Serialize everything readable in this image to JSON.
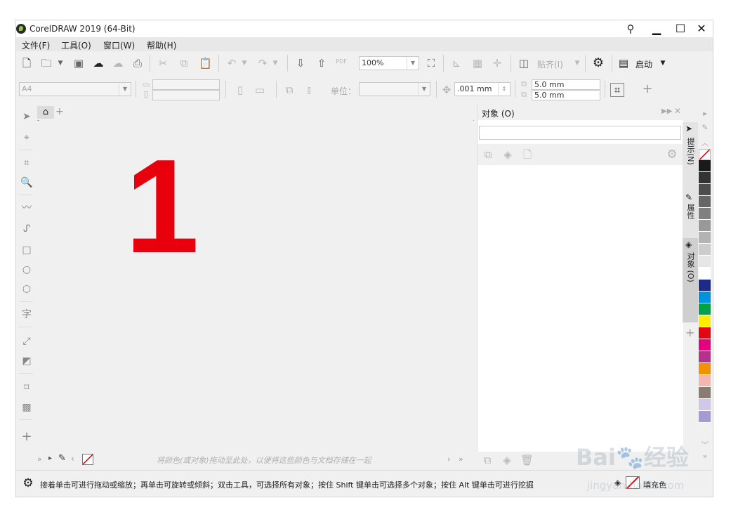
{
  "window": {
    "title": "CorelDRAW 2019 (64-Bit)",
    "minimize": "▁",
    "maximize": "☐",
    "close": "✕"
  },
  "menu": [
    "文件(F)",
    "工具(O)",
    "窗口(W)",
    "帮助(H)"
  ],
  "toolbar": {
    "zoom_value": "100%",
    "snap_label": "贴齐(I)",
    "launch_label": "启动",
    "pdf_icon_label": "PDF"
  },
  "property_bar": {
    "page_size": "A4",
    "units_label": "单位：",
    "nudge_value": ".001 mm",
    "dup_x": "5.0 mm",
    "dup_y": "5.0 mm"
  },
  "canvas": {
    "big_text": "1"
  },
  "objects_panel": {
    "title": "对象 (O)"
  },
  "side_tabs": [
    "提示(N)",
    "属性",
    "对象 (O)"
  ],
  "palette": {
    "swatches": [
      "#1a1a1a",
      "#333333",
      "#4d4d4d",
      "#666666",
      "#808080",
      "#999999",
      "#b3b3b3",
      "#cccccc",
      "#e6e6e6",
      "#ffffff",
      "#1e2a8a",
      "#0093dd",
      "#00a14b",
      "#ffed00",
      "#e30613",
      "#e5007e",
      "#b5328a",
      "#f39200",
      "#f4b7b0",
      "#8c7b70",
      "#d0c8e6",
      "#a59ad1"
    ]
  },
  "document_palette": {
    "hint": "将颜色(或对象)拖动至此处，以便将这些颜色与文档存储在一起"
  },
  "status": {
    "text": "接着单击可进行拖动或缩放；再单击可旋转或倾斜；双击工具，可选择所有对象；按住 Shift 键单击可选择多个对象；按住 Alt 键单击可进行挖掘",
    "fill_label": "填充色"
  },
  "watermark": {
    "brand": "Bai🐾经验",
    "url": "jingyan.baidu.com"
  }
}
